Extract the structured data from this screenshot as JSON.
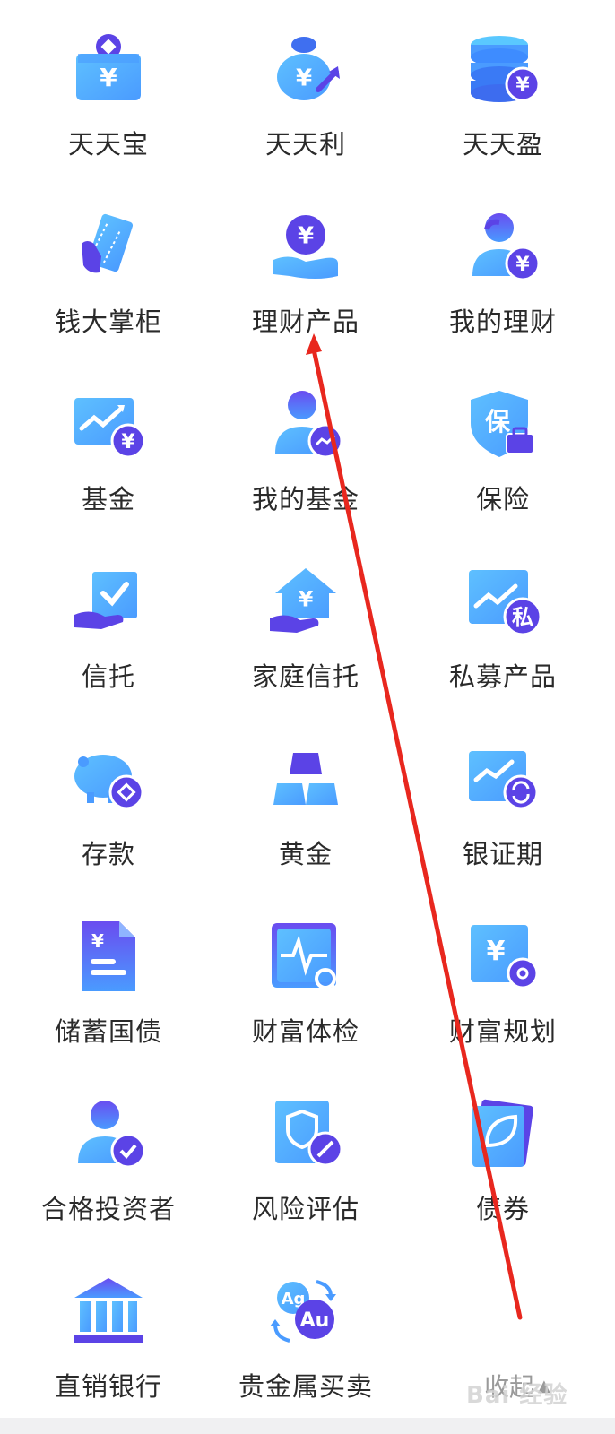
{
  "accent_gradient": [
    "#4a9bff",
    "#6a4cf0"
  ],
  "badge_color": "#5b43e6",
  "items": [
    {
      "label": "天天宝",
      "icon": "yen-wallet-icon"
    },
    {
      "label": "天天利",
      "icon": "yen-moneybag-icon"
    },
    {
      "label": "天天盈",
      "icon": "coin-stack-yen-icon"
    },
    {
      "label": "钱大掌柜",
      "icon": "hand-card-icon"
    },
    {
      "label": "理财产品",
      "icon": "hand-coin-icon"
    },
    {
      "label": "我的理财",
      "icon": "person-yen-icon"
    },
    {
      "label": "基金",
      "icon": "chart-yen-icon"
    },
    {
      "label": "我的基金",
      "icon": "person-chart-icon"
    },
    {
      "label": "保险",
      "icon": "shield-bao-icon"
    },
    {
      "label": "信托",
      "icon": "hand-check-icon"
    },
    {
      "label": "家庭信托",
      "icon": "house-yen-icon"
    },
    {
      "label": "私募产品",
      "icon": "chart-si-icon"
    },
    {
      "label": "存款",
      "icon": "piggy-bank-icon"
    },
    {
      "label": "黄金",
      "icon": "gold-bars-icon"
    },
    {
      "label": "银证期",
      "icon": "chart-exchange-icon"
    },
    {
      "label": "储蓄国债",
      "icon": "bond-document-icon"
    },
    {
      "label": "财富体检",
      "icon": "pulse-search-icon"
    },
    {
      "label": "财富规划",
      "icon": "yen-gear-icon"
    },
    {
      "label": "合格投资者",
      "icon": "person-check-icon"
    },
    {
      "label": "风险评估",
      "icon": "shield-pen-icon"
    },
    {
      "label": "债券",
      "icon": "leaf-card-icon"
    },
    {
      "label": "直销银行",
      "icon": "bank-building-icon"
    },
    {
      "label": "贵金属买卖",
      "icon": "ag-au-exchange-icon"
    }
  ],
  "collapse_label": "收起",
  "watermark_text": "Bai 经验"
}
